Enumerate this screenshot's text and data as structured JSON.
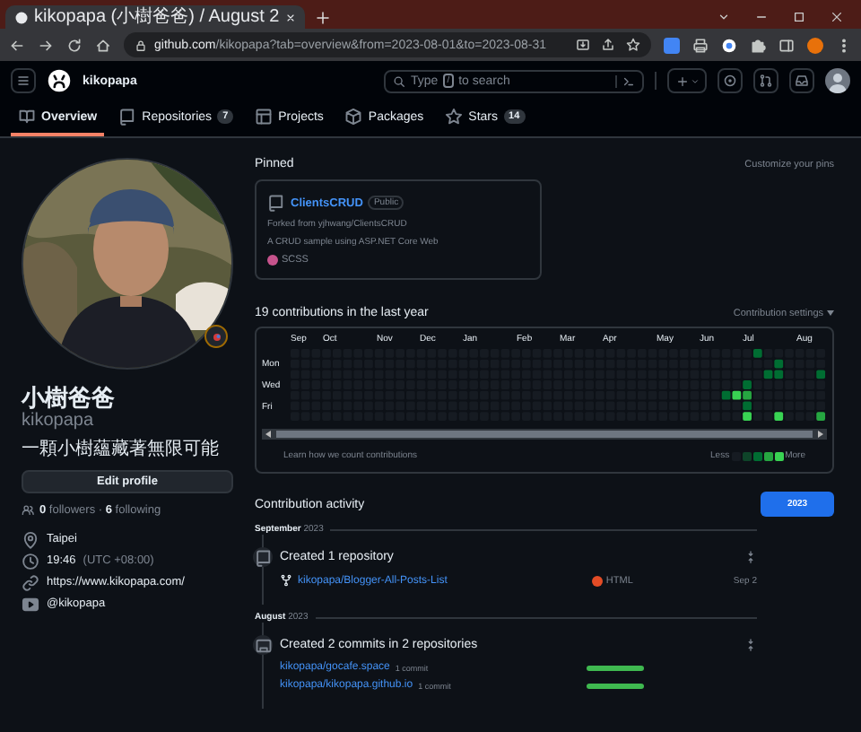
{
  "browser": {
    "tab": {
      "title": "kikopapa (小樹爸爸) / August 2",
      "selected": true
    },
    "url": {
      "host": "github.com",
      "path": "/kikopapa?tab=overview&from=2023-08-01&to=2023-08-31"
    }
  },
  "header": {
    "username": "kikopapa",
    "search": {
      "before": "Type",
      "key": "/",
      "after": "to search"
    }
  },
  "nav_tabs": [
    {
      "label": "Overview",
      "selected": true
    },
    {
      "label": "Repositories",
      "count": "7",
      "selected": false
    },
    {
      "label": "Projects",
      "selected": false
    },
    {
      "label": "Packages",
      "selected": false
    },
    {
      "label": "Stars",
      "count": "14",
      "selected": false
    }
  ],
  "profile": {
    "name": "小樹爸爸",
    "login": "kikopapa",
    "bio": "一顆小樹蘊藏著無限可能",
    "edit_button": "Edit profile",
    "follow": "**0** followers · **6** following",
    "details": [
      {
        "kind": "location",
        "text": "Taipei"
      },
      {
        "kind": "time",
        "text": "19:46",
        "note": "(UTC +08:00)"
      },
      {
        "kind": "link",
        "text": "https://www.kikopapa.com/"
      },
      {
        "kind": "social",
        "text": "@kikopapa"
      }
    ]
  },
  "pinned": {
    "title": "Pinned",
    "action": "Customize your pins",
    "cards": [
      {
        "name": "ClientsCRUD",
        "badge": "Public",
        "forked_from": "Forked from yjhwang/ClientsCRUD",
        "description": "A CRUD sample using ASP.NET Core Web",
        "language": "SCSS",
        "color": "#c6538c"
      }
    ]
  },
  "contributions": {
    "title": "19 contributions in the last year",
    "settings": "Contribution settings",
    "months": [
      "Sep",
      "Oct",
      "Nov",
      "Dec",
      "Jan",
      "Feb",
      "Mar",
      "Apr",
      "May",
      "Jun",
      "Jul",
      "Aug"
    ],
    "weekdays": [
      "Mon",
      "Wed",
      "Fri"
    ],
    "learn_link": "Learn how we count contributions",
    "less": "Less",
    "more": "More"
  },
  "activity": {
    "title": "Contribution activity",
    "year_button": "2023",
    "groups": [
      {
        "heading": "**September** 2023",
        "items": [
          {
            "kind": "repos",
            "title": "Created 1 repository",
            "entries": [
              {
                "name": "kikopapa/Blogger-All-Posts-List",
                "language": "HTML",
                "color": "#e34c26",
                "date": "Sep 2"
              }
            ]
          }
        ]
      },
      {
        "heading": "**August** 2023",
        "items": [
          {
            "kind": "commits",
            "title": "Created 2 commits in 2 repositories",
            "entries": [
              {
                "name": "kikopapa/gocafe.space",
                "note": "1 commit"
              },
              {
                "name": "kikopapa/kikopapa.github.io",
                "note": "1 commit"
              }
            ]
          }
        ]
      }
    ]
  }
}
